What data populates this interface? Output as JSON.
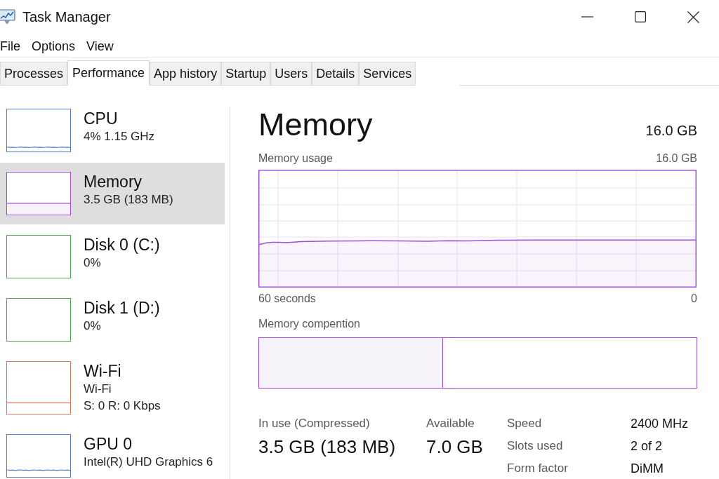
{
  "window": {
    "title": "Task Manager"
  },
  "menu": [
    "File",
    "Options",
    "View"
  ],
  "tabs": [
    {
      "label": "Processes",
      "selected": false
    },
    {
      "label": "Performance",
      "selected": true
    },
    {
      "label": "App history",
      "selected": false
    },
    {
      "label": "Startup",
      "selected": false
    },
    {
      "label": "Users",
      "selected": false
    },
    {
      "label": "Details",
      "selected": false
    },
    {
      "label": "Services",
      "selected": false
    }
  ],
  "sidebar": {
    "items": [
      {
        "title": "CPU",
        "details": [
          "4% 1.15 GHz"
        ],
        "color": "#5a7cc4",
        "selected": false
      },
      {
        "title": "Memory",
        "details": [
          "3.5 GB (183 MB)"
        ],
        "color": "#a64fd6",
        "selected": true
      },
      {
        "title": "Disk 0 (C:)",
        "details": [
          "0%"
        ],
        "color": "#4caa4c",
        "selected": false
      },
      {
        "title": "Disk 1 (D:)",
        "details": [
          "0%"
        ],
        "color": "#4caa4c",
        "selected": false
      },
      {
        "title": "Wi-Fi",
        "details": [
          "Wi-Fi",
          "S: 0 R: 0 Kbps"
        ],
        "color": "#d97a55",
        "selected": false
      },
      {
        "title": "GPU 0",
        "details": [
          "Intel(R) UHD Graphics 6"
        ],
        "color": "#5a7cc4",
        "selected": false
      }
    ]
  },
  "panel": {
    "title": "Memory",
    "total": "16.0 GB",
    "usage_graph": {
      "label": "Memory usage",
      "max_label": "16.0 GB",
      "time_label": "60 seconds",
      "zero_label": "0"
    },
    "composition": {
      "label": "Memory compention",
      "level": 0.42
    },
    "stats": [
      {
        "label": "In use (Compressed)",
        "value": "3.5 GB (183 MB)"
      },
      {
        "label": "Available",
        "value": "7.0 GB"
      }
    ],
    "properties": [
      {
        "label": "Speed",
        "value": "2400 MHz"
      },
      {
        "label": "Slots used",
        "value": "2 of 2"
      },
      {
        "label": "Form factor",
        "value": "DiMM"
      }
    ]
  }
}
